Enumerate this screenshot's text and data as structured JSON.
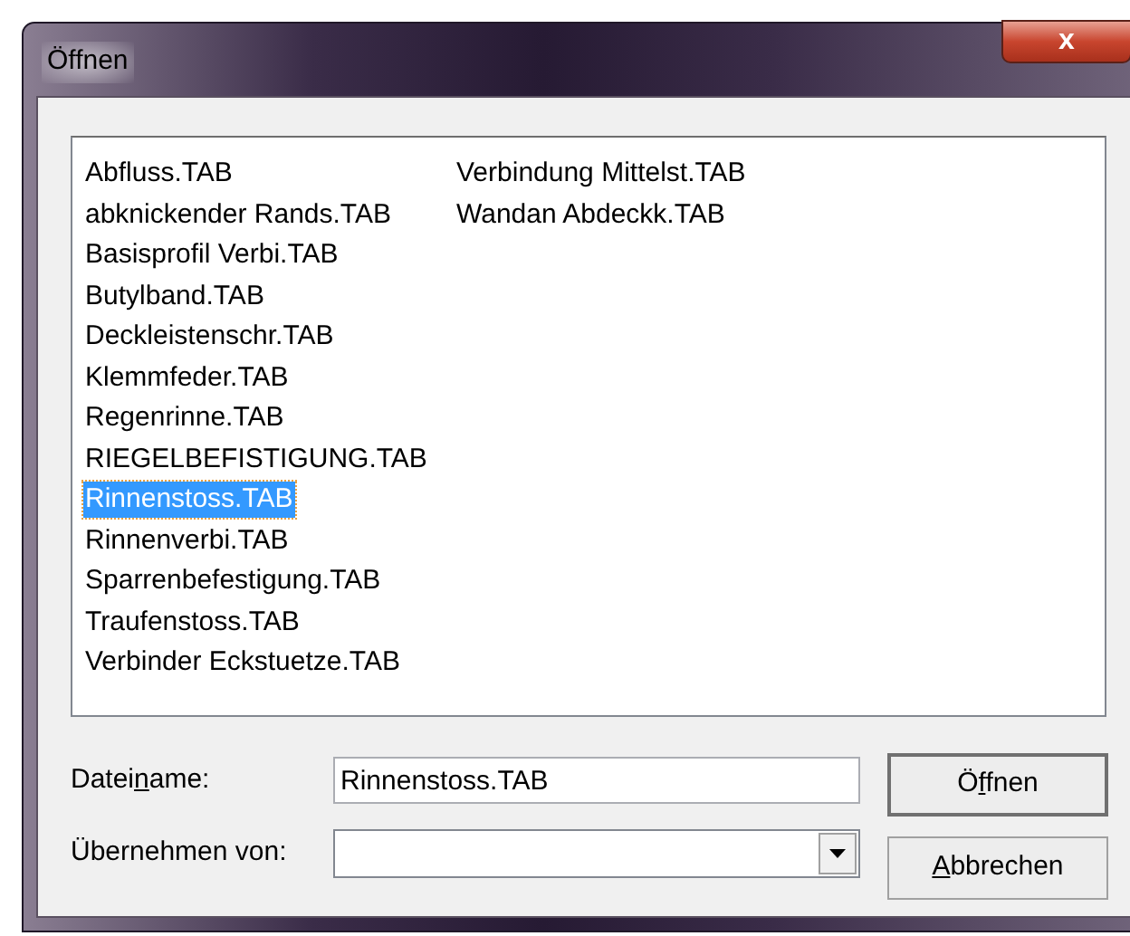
{
  "window": {
    "title": "Öffnen",
    "close_label": "x"
  },
  "file_list": {
    "items": [
      {
        "label": "Abfluss.TAB",
        "selected": false
      },
      {
        "label": "abknickender Rands.TAB",
        "selected": false
      },
      {
        "label": "Basisprofil Verbi.TAB",
        "selected": false
      },
      {
        "label": "Butylband.TAB",
        "selected": false
      },
      {
        "label": "Deckleistenschr.TAB",
        "selected": false
      },
      {
        "label": "Klemmfeder.TAB",
        "selected": false
      },
      {
        "label": "Regenrinne.TAB",
        "selected": false
      },
      {
        "label": "RIEGELBEFISTIGUNG.TAB",
        "selected": false
      },
      {
        "label": "Rinnenstoss.TAB",
        "selected": true
      },
      {
        "label": "Rinnenverbi.TAB",
        "selected": false
      },
      {
        "label": "Sparrenbefestigung.TAB",
        "selected": false
      },
      {
        "label": "Traufenstoss.TAB",
        "selected": false
      },
      {
        "label": "Verbinder Eckstuetze.TAB",
        "selected": false
      },
      {
        "label": "Verbindung Mittelst.TAB",
        "selected": false
      },
      {
        "label": "Wandan Abdeckk.TAB",
        "selected": false
      }
    ]
  },
  "filename": {
    "label_parts": [
      {
        "text": "Datei",
        "accel": false
      },
      {
        "text": "n",
        "accel": true
      },
      {
        "text": "ame:",
        "accel": false
      }
    ],
    "value": "Rinnenstoss.TAB"
  },
  "take_from": {
    "label_parts": [
      {
        "text": "Übernehmen von:",
        "accel": false
      }
    ]
  },
  "buttons": [
    {
      "label_parts": [
        {
          "text": "Ö",
          "accel": false
        },
        {
          "text": "f",
          "accel": true
        },
        {
          "text": "fnen",
          "accel": false
        }
      ],
      "default": true
    },
    {
      "label_parts": [
        {
          "text": "A",
          "accel": true
        },
        {
          "text": "bbrechen",
          "accel": false
        }
      ],
      "default": false
    }
  ]
}
